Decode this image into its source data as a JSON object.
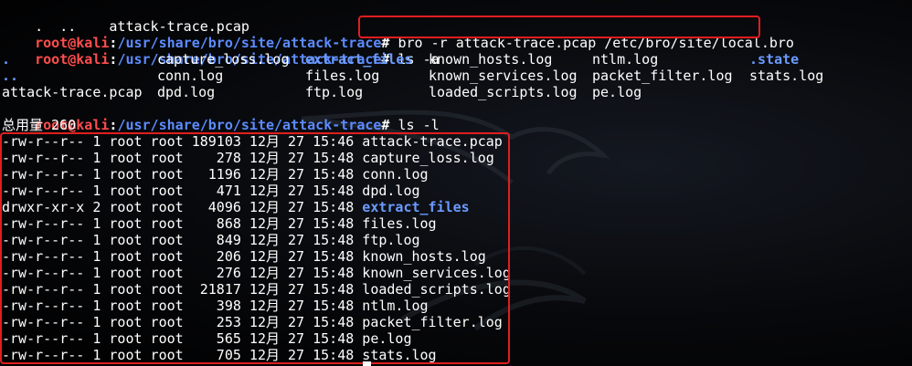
{
  "line_top": {
    "dots": ".  ..",
    "file": "attack-trace.pcap"
  },
  "prompt": {
    "user": "root@kali",
    "sep": ":",
    "path": "/usr/share/bro/site/attack-trace",
    "hash": "#"
  },
  "commands": {
    "bro": "bro -r attack-trace.pcap /etc/bro/site/local.bro",
    "ls_a": "ls -a",
    "ls_l": "ls -l"
  },
  "ls_a_grid": [
    [
      ".",
      "capture_loss.log",
      "extract_files",
      "known_hosts.log",
      "ntlm.log",
      ".state"
    ],
    [
      "..",
      "conn.log",
      "files.log",
      "known_services.log",
      "packet_filter.log",
      "stats.log"
    ],
    [
      "attack-trace.pcap",
      "dpd.log",
      "ftp.log",
      "loaded_scripts.log",
      "pe.log",
      ""
    ]
  ],
  "ls_l_total": "总用量 260",
  "ls_l_rows": [
    {
      "perm": "-rw-r--r--",
      "links": "1",
      "owner": "root",
      "group": "root",
      "size": "189103",
      "month": "12月",
      "day": "27",
      "time": "15:46",
      "name": "attack-trace.pcap",
      "dir": false
    },
    {
      "perm": "-rw-r--r--",
      "links": "1",
      "owner": "root",
      "group": "root",
      "size": "278",
      "month": "12月",
      "day": "27",
      "time": "15:48",
      "name": "capture_loss.log",
      "dir": false
    },
    {
      "perm": "-rw-r--r--",
      "links": "1",
      "owner": "root",
      "group": "root",
      "size": "1196",
      "month": "12月",
      "day": "27",
      "time": "15:48",
      "name": "conn.log",
      "dir": false
    },
    {
      "perm": "-rw-r--r--",
      "links": "1",
      "owner": "root",
      "group": "root",
      "size": "471",
      "month": "12月",
      "day": "27",
      "time": "15:48",
      "name": "dpd.log",
      "dir": false
    },
    {
      "perm": "drwxr-xr-x",
      "links": "2",
      "owner": "root",
      "group": "root",
      "size": "4096",
      "month": "12月",
      "day": "27",
      "time": "15:48",
      "name": "extract_files",
      "dir": true
    },
    {
      "perm": "-rw-r--r--",
      "links": "1",
      "owner": "root",
      "group": "root",
      "size": "868",
      "month": "12月",
      "day": "27",
      "time": "15:48",
      "name": "files.log",
      "dir": false
    },
    {
      "perm": "-rw-r--r--",
      "links": "1",
      "owner": "root",
      "group": "root",
      "size": "849",
      "month": "12月",
      "day": "27",
      "time": "15:48",
      "name": "ftp.log",
      "dir": false
    },
    {
      "perm": "-rw-r--r--",
      "links": "1",
      "owner": "root",
      "group": "root",
      "size": "206",
      "month": "12月",
      "day": "27",
      "time": "15:48",
      "name": "known_hosts.log",
      "dir": false
    },
    {
      "perm": "-rw-r--r--",
      "links": "1",
      "owner": "root",
      "group": "root",
      "size": "276",
      "month": "12月",
      "day": "27",
      "time": "15:48",
      "name": "known_services.log",
      "dir": false
    },
    {
      "perm": "-rw-r--r--",
      "links": "1",
      "owner": "root",
      "group": "root",
      "size": "21817",
      "month": "12月",
      "day": "27",
      "time": "15:48",
      "name": "loaded_scripts.log",
      "dir": false
    },
    {
      "perm": "-rw-r--r--",
      "links": "1",
      "owner": "root",
      "group": "root",
      "size": "398",
      "month": "12月",
      "day": "27",
      "time": "15:48",
      "name": "ntlm.log",
      "dir": false
    },
    {
      "perm": "-rw-r--r--",
      "links": "1",
      "owner": "root",
      "group": "root",
      "size": "253",
      "month": "12月",
      "day": "27",
      "time": "15:48",
      "name": "packet_filter.log",
      "dir": false
    },
    {
      "perm": "-rw-r--r--",
      "links": "1",
      "owner": "root",
      "group": "root",
      "size": "565",
      "month": "12月",
      "day": "27",
      "time": "15:48",
      "name": "pe.log",
      "dir": false
    },
    {
      "perm": "-rw-r--r--",
      "links": "1",
      "owner": "root",
      "group": "root",
      "size": "705",
      "month": "12月",
      "day": "27",
      "time": "15:48",
      "name": "stats.log",
      "dir": false
    }
  ],
  "colors": {
    "user": "#ff4d4d",
    "path": "#5c8cff",
    "dir": "#6b9bff",
    "highlight": "#e01e1e",
    "background": "#000000"
  },
  "icons": {
    "background": "kali-dragon-watermark"
  }
}
